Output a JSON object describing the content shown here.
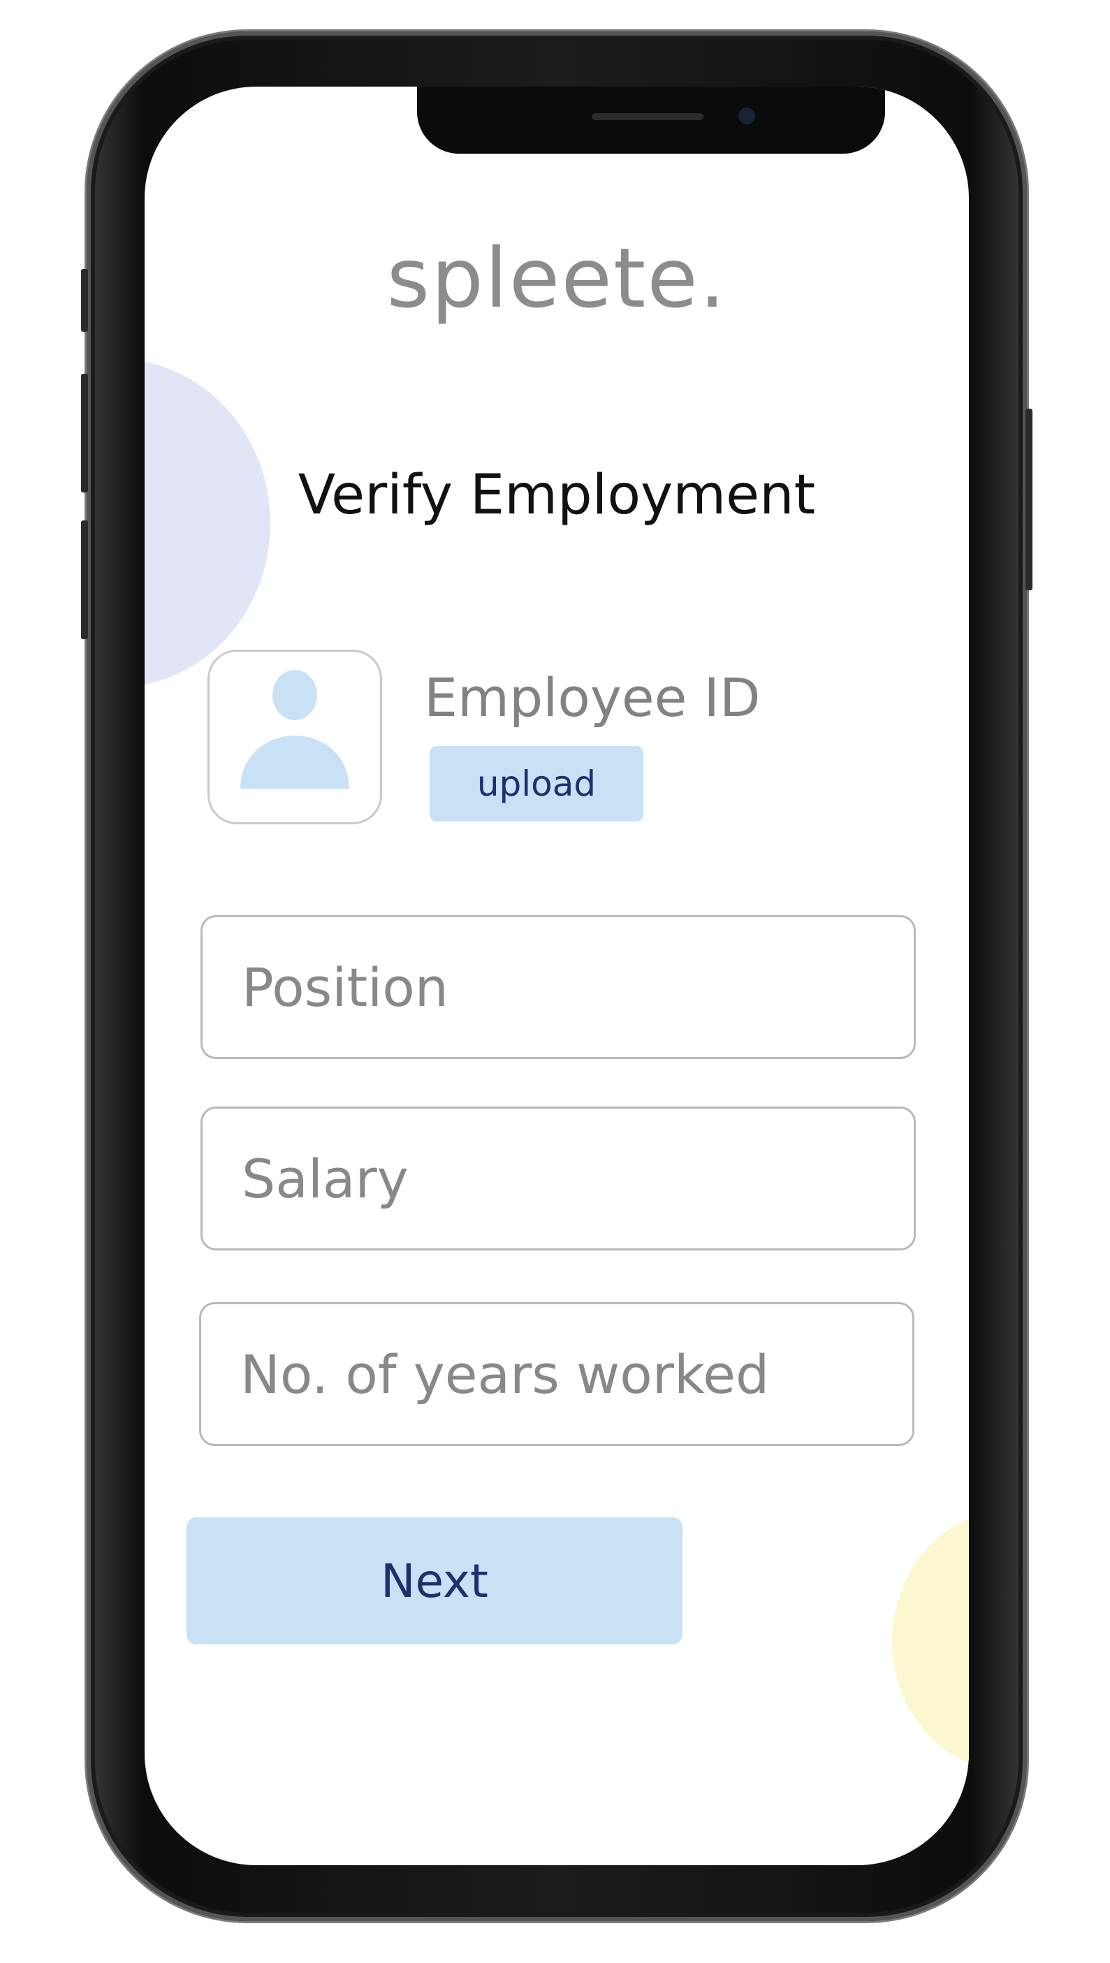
{
  "app": {
    "brand": "spleete.",
    "title": "Verify Employment"
  },
  "employee_id": {
    "label": "Employee ID",
    "upload_label": "upload",
    "placeholder_icon": "person-avatar-icon"
  },
  "form": {
    "position_placeholder": "Position",
    "salary_placeholder": "Salary",
    "years_placeholder": "No. of years worked"
  },
  "actions": {
    "next_label": "Next"
  },
  "colors": {
    "accent_light_blue": "#c8e1f5",
    "accent_text_navy": "#1f2f6e",
    "blob_blue": "#e1e5f5",
    "blob_yellow": "#fbf8d1"
  }
}
